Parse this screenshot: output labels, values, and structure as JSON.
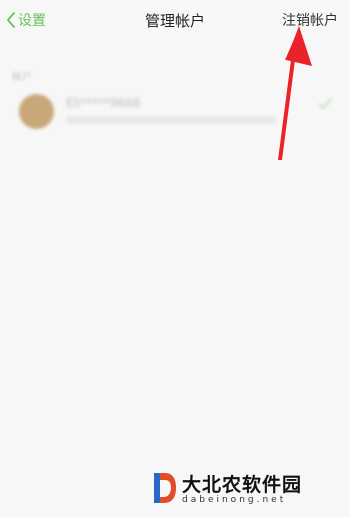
{
  "nav": {
    "back_label": "设置",
    "title": "管理帐户",
    "right_action": "注销帐户"
  },
  "section": {
    "label": "帐户"
  },
  "account": {
    "name": "Eli*****9666"
  },
  "watermark": {
    "name": "大北农软件园",
    "url": "dabeinong.net"
  },
  "colors": {
    "accent": "#6ac25a",
    "arrow": "#e8242a",
    "background": "#f7f7f7"
  },
  "icons": {
    "back": "chevron-left-icon",
    "selected": "check-icon"
  }
}
